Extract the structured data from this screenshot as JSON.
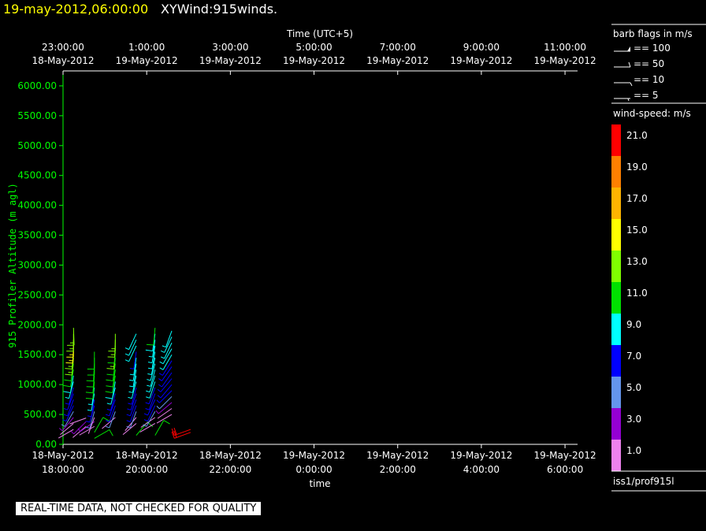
{
  "header": {
    "timestamp": "19-may-2012,06:00:00",
    "product": "XYWind:915winds."
  },
  "chart_data": {
    "type": "wind-barb",
    "top_axis": {
      "label": "Time (UTC+5)",
      "ticks": [
        {
          "x": 0,
          "time": "23:00:00",
          "date": "18-May-2012"
        },
        {
          "x": 2,
          "time": "1:00:00",
          "date": "19-May-2012"
        },
        {
          "x": 4,
          "time": "3:00:00",
          "date": "19-May-2012"
        },
        {
          "x": 6,
          "time": "5:00:00",
          "date": "19-May-2012"
        },
        {
          "x": 8,
          "time": "7:00:00",
          "date": "19-May-2012"
        },
        {
          "x": 10,
          "time": "9:00:00",
          "date": "19-May-2012"
        },
        {
          "x": 12,
          "time": "11:00:00",
          "date": "19-May-2012"
        }
      ]
    },
    "bottom_axis": {
      "label": "time",
      "ticks": [
        {
          "x": 0,
          "date": "18-May-2012",
          "time": "18:00:00"
        },
        {
          "x": 2,
          "date": "18-May-2012",
          "time": "20:00:00"
        },
        {
          "x": 4,
          "date": "18-May-2012",
          "time": "22:00:00"
        },
        {
          "x": 6,
          "date": "19-May-2012",
          "time": "0:00:00"
        },
        {
          "x": 8,
          "date": "19-May-2012",
          "time": "2:00:00"
        },
        {
          "x": 10,
          "date": "19-May-2012",
          "time": "4:00:00"
        },
        {
          "x": 12,
          "date": "19-May-2012",
          "time": "6:00:00"
        }
      ],
      "xlim": [
        0,
        12.3
      ]
    },
    "y_axis": {
      "label": "915 Profiler Altitude (m agl)",
      "ticks": [
        "0.00",
        "500.00",
        "1000.00",
        "1500.00",
        "2000.00",
        "2500.00",
        "3000.00",
        "3500.00",
        "4000.00",
        "4500.00",
        "5000.00",
        "5500.00",
        "6000.00"
      ],
      "ylim": [
        0,
        6250
      ]
    },
    "barb_legend": {
      "title": "barb flags in m/s",
      "items": [
        "== 100",
        "== 50",
        "== 10",
        "== 5"
      ]
    },
    "color_legend": {
      "title": "wind-speed: m/s",
      "levels": [
        {
          "label": "21.0",
          "color": "#ff0000"
        },
        {
          "label": "19.0",
          "color": "#ff8000"
        },
        {
          "label": "17.0",
          "color": "#ffb400"
        },
        {
          "label": "15.0",
          "color": "#ffff00"
        },
        {
          "label": "13.0",
          "color": "#80ff00"
        },
        {
          "label": "11.0",
          "color": "#00e000"
        },
        {
          "label": "9.0",
          "color": "#00ffff"
        },
        {
          "label": "7.0",
          "color": "#0000ff"
        },
        {
          "label": "5.0",
          "color": "#6495ed"
        },
        {
          "label": "3.0",
          "color": "#9400d3"
        },
        {
          "label": "1.0",
          "color": "#ee82ee"
        }
      ]
    },
    "profiles": [
      {
        "x": 0.25,
        "barbs": [
          [
            250,
            1.0,
            240
          ],
          [
            350,
            2.0,
            230
          ],
          [
            450,
            3.5,
            220
          ],
          [
            550,
            5.5,
            210
          ],
          [
            650,
            6.5,
            205
          ],
          [
            750,
            7.0,
            200
          ],
          [
            850,
            7.5,
            200
          ],
          [
            950,
            8.0,
            195
          ],
          [
            1050,
            9.0,
            195
          ],
          [
            1150,
            10.0,
            190
          ],
          [
            1250,
            11.0,
            190
          ],
          [
            1350,
            12.0,
            188
          ],
          [
            1450,
            13.0,
            185
          ],
          [
            1550,
            14.0,
            185
          ],
          [
            1650,
            14.5,
            182
          ],
          [
            1750,
            15.0,
            180
          ],
          [
            1850,
            14.0,
            180
          ],
          [
            1950,
            13.0,
            178
          ]
        ]
      },
      {
        "x": 0.55,
        "barbs": [
          [
            300,
            1.5,
            230
          ],
          [
            380,
            2.5,
            225
          ],
          [
            440,
            1.0,
            250
          ]
        ]
      },
      {
        "x": 0.75,
        "barbs": [
          [
            300,
            2.0,
            240
          ],
          [
            380,
            2.5,
            235
          ]
        ]
      },
      {
        "x": 0.75,
        "barbs": [
          [
            100,
            11.0,
            60
          ],
          [
            200,
            12.0,
            30
          ],
          [
            450,
            1.5,
            200
          ],
          [
            550,
            5.0,
            195
          ],
          [
            650,
            6.5,
            195
          ],
          [
            750,
            7.0,
            190
          ],
          [
            850,
            8.5,
            190
          ],
          [
            950,
            9.5,
            188
          ],
          [
            1050,
            10.5,
            185
          ],
          [
            1150,
            11.5,
            185
          ],
          [
            1250,
            12.0,
            183
          ],
          [
            1350,
            11.5,
            183
          ],
          [
            1450,
            11.0,
            180
          ],
          [
            1550,
            11.5,
            180
          ]
        ]
      },
      {
        "x": 1.25,
        "barbs": [
          [
            450,
            1.5,
            230
          ],
          [
            550,
            5.0,
            200
          ],
          [
            650,
            6.5,
            200
          ],
          [
            750,
            7.0,
            200
          ],
          [
            850,
            8.0,
            195
          ],
          [
            950,
            9.0,
            195
          ],
          [
            1050,
            10.0,
            190
          ],
          [
            1150,
            11.0,
            190
          ],
          [
            1250,
            11.5,
            188
          ],
          [
            1350,
            11.0,
            188
          ],
          [
            1450,
            12.0,
            185
          ],
          [
            1550,
            12.5,
            185
          ],
          [
            1650,
            12.0,
            182
          ],
          [
            1750,
            12.5,
            182
          ],
          [
            1850,
            13.0,
            180
          ]
        ]
      },
      {
        "x": 1.75,
        "barbs": [
          [
            150,
            11.0,
            40
          ],
          [
            350,
            1.5,
            230
          ],
          [
            450,
            2.0,
            220
          ],
          [
            550,
            5.0,
            200
          ],
          [
            650,
            6.5,
            200
          ],
          [
            750,
            7.0,
            200
          ],
          [
            850,
            7.5,
            198
          ],
          [
            950,
            8.0,
            195
          ],
          [
            1050,
            8.5,
            195
          ],
          [
            1150,
            8.5,
            192
          ],
          [
            1250,
            9.0,
            190
          ],
          [
            1350,
            9.0,
            190
          ],
          [
            1450,
            8.5,
            188
          ],
          [
            1550,
            8.0,
            188
          ]
        ]
      },
      {
        "x": 1.75,
        "barbs": [
          [
            1650,
            9.0,
            205
          ],
          [
            1750,
            9.0,
            205
          ],
          [
            1850,
            9.5,
            205
          ]
        ]
      },
      {
        "x": 2.2,
        "barbs": [
          [
            150,
            11.0,
            30
          ],
          [
            350,
            1.5,
            240
          ],
          [
            450,
            2.0,
            235
          ],
          [
            550,
            5.0,
            210
          ],
          [
            650,
            6.5,
            205
          ],
          [
            750,
            7.0,
            205
          ],
          [
            850,
            7.5,
            200
          ],
          [
            950,
            8.0,
            200
          ],
          [
            1050,
            8.5,
            198
          ],
          [
            1150,
            9.0,
            198
          ],
          [
            1250,
            9.5,
            195
          ],
          [
            1350,
            9.5,
            195
          ],
          [
            1450,
            9.0,
            192
          ],
          [
            1550,
            8.5,
            190
          ],
          [
            1650,
            8.5,
            190
          ],
          [
            1750,
            9.5,
            188
          ],
          [
            1850,
            10.0,
            188
          ],
          [
            1950,
            11.0,
            185
          ]
        ]
      },
      {
        "x": 2.6,
        "barbs": [
          [
            500,
            1.5,
            240
          ],
          [
            600,
            2.0,
            235
          ],
          [
            700,
            3.5,
            230
          ],
          [
            800,
            5.0,
            225
          ],
          [
            900,
            6.5,
            225
          ],
          [
            1000,
            7.0,
            220
          ],
          [
            1100,
            7.0,
            220
          ],
          [
            1200,
            7.0,
            215
          ],
          [
            1300,
            7.5,
            215
          ],
          [
            1400,
            8.0,
            212
          ],
          [
            1500,
            8.5,
            210
          ],
          [
            1600,
            8.5,
            210
          ],
          [
            1700,
            9.0,
            205
          ],
          [
            1800,
            9.5,
            205
          ],
          [
            1900,
            9.0,
            200
          ]
        ]
      },
      {
        "x": 3.05,
        "barbs": [
          [
            200,
            21.0,
            250
          ],
          [
            250,
            21.0,
            250
          ]
        ]
      }
    ]
  },
  "footer": {
    "source": "iss1/prof915l",
    "quality_notice": "REAL-TIME DATA, NOT CHECKED FOR QUALITY"
  }
}
